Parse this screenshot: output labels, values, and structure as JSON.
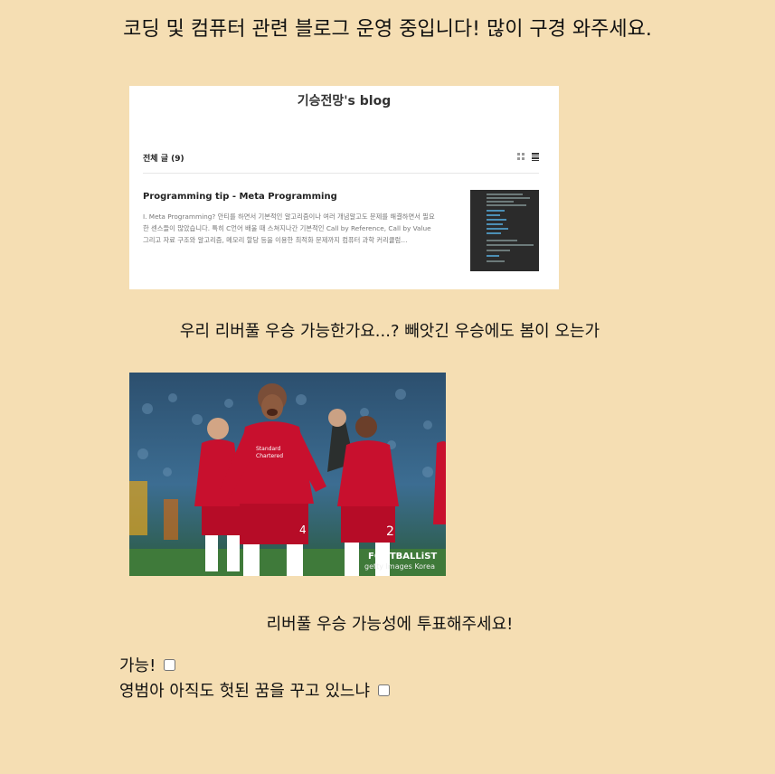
{
  "header": {
    "title": "코딩 및 컴퓨터 관련 블로그 운영 중입니다! 많이 구경 와주세요."
  },
  "blog_preview": {
    "blog_name": "기승전망's blog",
    "posts_header": "전체 글 (9)",
    "view_icons": [
      "grid-icon",
      "list-icon"
    ],
    "post": {
      "title": "Programming tip - Meta Programming",
      "excerpt": "I. Meta Programming? 안티를 하면서 기본적인 알고리즘이나 여러 개념알고도 문제를 해결하면서 필요한 센스들이 많았습니다. 특히 C언어 배울 때 스쳐지나간 기본적인 Call by Reference, Call by Value 그리고 자료 구조와 알고리즘, 메모리 할당 등을 이용한 최적화 문제까지 컴퓨터 과학 커리큘럼…"
    }
  },
  "question": {
    "text": "우리 리버풀 우승 가능한가요...? 빼앗긴 우승에도 봄이 오는가"
  },
  "photo": {
    "watermark_title": "FOOTBALLiST",
    "watermark_sub": "getty Images Korea"
  },
  "poll": {
    "prompt": "리버풀 우승 가능성에 투표해주세요!",
    "options": [
      {
        "label": "가능!",
        "checked": false
      },
      {
        "label": "영범아 아직도 헛된 꿈을 꾸고 있느냐",
        "checked": false
      }
    ]
  },
  "colors": {
    "page_background": "#f5deb3",
    "kit_red": "#c8102e"
  }
}
